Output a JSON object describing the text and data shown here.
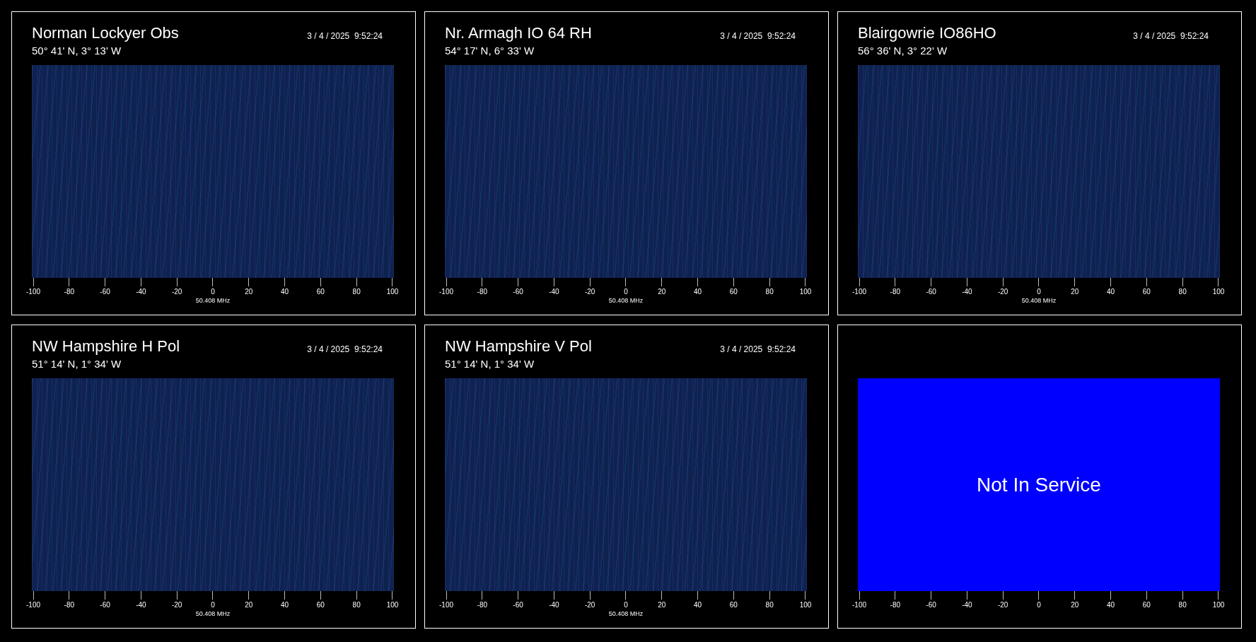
{
  "panels": [
    {
      "kind": "spectrogram",
      "title": "Norman Lockyer Obs",
      "timestamp": "3 / 4 / 2025  9:52:24",
      "location": "50° 41' N, 3° 13' W",
      "ticks": [
        "-100",
        "-80",
        "-60",
        "-40",
        "-20",
        "0",
        "20",
        "40",
        "60",
        "80",
        "100"
      ],
      "axis_label": "50.408 MHz"
    },
    {
      "kind": "spectrogram",
      "title": "Nr. Armagh  IO 64 RH",
      "timestamp": "3 / 4 / 2025  9:52:24",
      "location": "54° 17' N, 6° 33' W",
      "ticks": [
        "-100",
        "-80",
        "-60",
        "-40",
        "-20",
        "0",
        "20",
        "40",
        "60",
        "80",
        "100"
      ],
      "axis_label": "50.408 MHz"
    },
    {
      "kind": "spectrogram",
      "title": "Blairgowrie IO86HO",
      "timestamp": "3 / 4 / 2025  9:52:24",
      "location": "56° 36' N, 3° 22' W",
      "ticks": [
        "-100",
        "-80",
        "-60",
        "-40",
        "-20",
        "0",
        "20",
        "40",
        "60",
        "80",
        "100"
      ],
      "axis_label": "50.408 MHz"
    },
    {
      "kind": "spectrogram",
      "title": "NW Hampshire H Pol",
      "timestamp": "3 / 4 / 2025  9:52:24",
      "location": "51° 14' N, 1° 34' W",
      "ticks": [
        "-100",
        "-80",
        "-60",
        "-40",
        "-20",
        "0",
        "20",
        "40",
        "60",
        "80",
        "100"
      ],
      "axis_label": "50.408 MHz"
    },
    {
      "kind": "spectrogram",
      "title": "NW Hampshire V Pol",
      "timestamp": "3 / 4 / 2025  9:52:24",
      "location": "51° 14' N, 1° 34' W",
      "ticks": [
        "-100",
        "-80",
        "-60",
        "-40",
        "-20",
        "0",
        "20",
        "40",
        "60",
        "80",
        "100"
      ],
      "axis_label": "50.408 MHz"
    },
    {
      "kind": "out_of_service",
      "message": "Not In Service",
      "ticks": [
        "-100",
        "-80",
        "-60",
        "-40",
        "-20",
        "0",
        "20",
        "40",
        "60",
        "80",
        "100"
      ]
    }
  ]
}
